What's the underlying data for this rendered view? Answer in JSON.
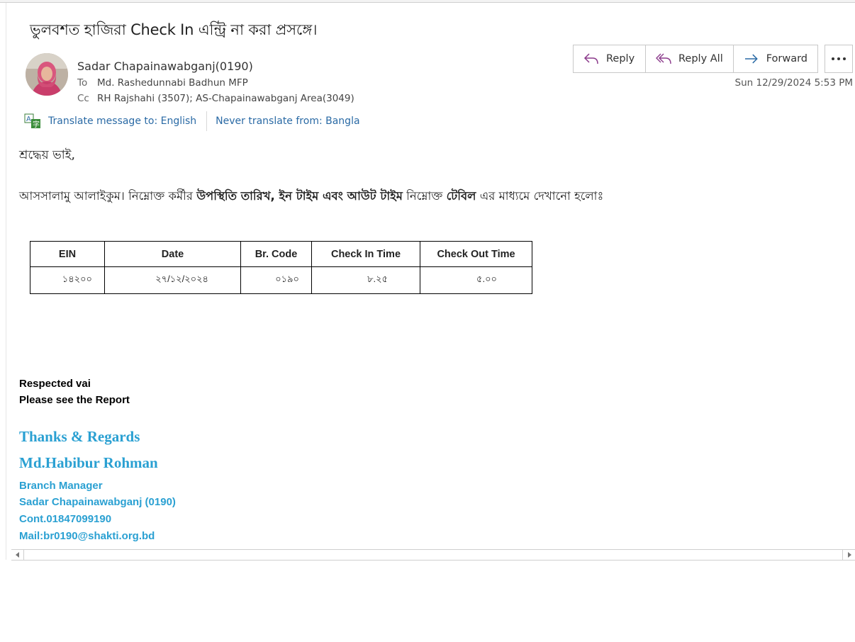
{
  "message": {
    "subject": "ভুলবশত হাজিরা Check In এন্ট্রি না করা প্রসঙ্গে।",
    "sender": "Sadar Chapainawabganj(0190)",
    "to_label": "To",
    "to": "Md. Rashedunnabi Badhun MFP",
    "cc_label": "Cc",
    "cc": "RH Rajshahi (3507); AS-Chapainawabganj Area(3049)",
    "timestamp": "Sun 12/29/2024 5:53 PM"
  },
  "actions": {
    "reply": "Reply",
    "reply_all": "Reply All",
    "forward": "Forward"
  },
  "translate": {
    "translate_link": "Translate message to: English",
    "never_link": "Never translate from: Bangla"
  },
  "body": {
    "greeting": "শ্রদ্ধেয় ভাই,",
    "salam_1": "আসসালামু আলাইকুম। নিম্নোক্ত কর্মীর ",
    "salam_bold_1": "উপস্থিতি তারিখ, ইন টাইম এবং আউট টাইম",
    "salam_2": " নিম্নোক্ত ",
    "salam_bold_2": "টেবিল",
    "salam_3": " এর মাধ্যমে দেখানো হলোঃ"
  },
  "table": {
    "headers": [
      "EIN",
      "Date",
      "Br. Code",
      "Check In Time",
      "Check Out Time"
    ],
    "rows": [
      [
        "১৪২০০",
        "২৭/১২/২০২৪",
        "০১৯০",
        "৮.২৫",
        "৫.০০"
      ]
    ]
  },
  "footer": {
    "respected": "Respected vai",
    "please": "Please see the Report",
    "thanks": "Thanks & Regards",
    "name": "Md.Habibur Rohman",
    "title": "Branch Manager",
    "branch": "Sadar Chapainawabganj (0190)",
    "contact": "Cont.01847099190",
    "mail": "Mail:br0190@shakti.org.bd"
  },
  "colors": {
    "link": "#2a6aa5",
    "signature": "#2aa0d2",
    "reply_icon": "#8b3a8b",
    "forward_icon": "#2a6aa5"
  }
}
